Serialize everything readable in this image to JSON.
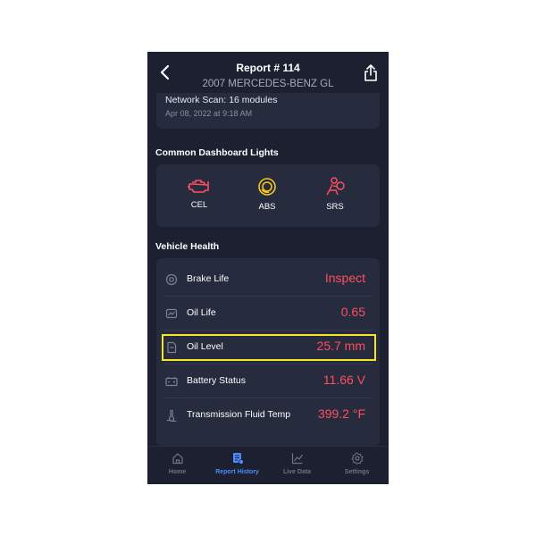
{
  "header": {
    "title": "Report # 114",
    "subtitle": "2007 MERCEDES-BENZ GL"
  },
  "scan": {
    "title": "Network Scan: 16 modules",
    "date": "Apr 08, 2022 at 9:18 AM"
  },
  "dashboard": {
    "heading": "Common Dashboard Lights",
    "lights": [
      {
        "label": "CEL",
        "icon": "engine-icon",
        "color": "#ff4f5f"
      },
      {
        "label": "ABS",
        "icon": "abs-brake-icon",
        "color": "#f5c518"
      },
      {
        "label": "SRS",
        "icon": "airbag-icon",
        "color": "#ff4f5f"
      }
    ]
  },
  "health": {
    "heading": "Vehicle Health",
    "rows": [
      {
        "name": "Brake Life",
        "value": "Inspect",
        "icon": "brake-icon"
      },
      {
        "name": "Oil Life",
        "value": "0.65",
        "icon": "oil-life-icon"
      },
      {
        "name": "Oil Level",
        "value": "25.7 mm",
        "icon": "oil-level-icon"
      },
      {
        "name": "Battery Status",
        "value": "11.66 V",
        "icon": "battery-icon"
      },
      {
        "name": "Transmission Fluid Temp",
        "value": "399.2 °F",
        "icon": "temperature-icon"
      }
    ]
  },
  "tabs": [
    {
      "label": "Home",
      "icon": "home-icon",
      "active": false
    },
    {
      "label": "Report History",
      "icon": "report-icon",
      "active": true
    },
    {
      "label": "Live Data",
      "icon": "chart-icon",
      "active": false
    },
    {
      "label": "Settings",
      "icon": "gear-icon",
      "active": false
    }
  ],
  "colors": {
    "background": "#1c2030",
    "card": "#262b3d",
    "value_red": "#ff4f5f",
    "active_tab": "#4a8cff",
    "highlight": "#f5e623"
  }
}
